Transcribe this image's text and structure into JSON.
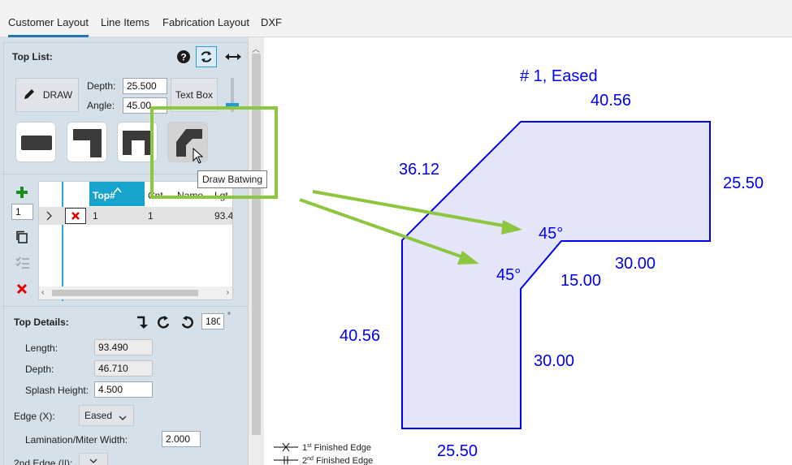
{
  "tabs": [
    {
      "label": "Customer Layout",
      "active": true
    },
    {
      "label": "Line Items",
      "active": false
    },
    {
      "label": "Fabrication Layout",
      "active": false
    },
    {
      "label": "DXF",
      "active": false
    }
  ],
  "top_list": {
    "title": "Top List:",
    "draw_label": "DRAW",
    "depth_label": "Depth:",
    "depth_value": "25.500",
    "angle_label": "Angle:",
    "angle_value": "45.00",
    "text_box_label": "Text Box",
    "tooltip": "Draw Batwing"
  },
  "grid": {
    "add_count": "1",
    "columns": [
      "Top#",
      "Cnt",
      "Name",
      "Lgt"
    ],
    "rows": [
      {
        "top": "1",
        "cnt": "1",
        "name": "",
        "lgt": "93.4"
      }
    ]
  },
  "top_details": {
    "title": "Top Details:",
    "rotate_value": "180",
    "degree_symbol": "°",
    "length_label": "Length:",
    "length_value": "93.490",
    "depth_label": "Depth:",
    "depth_value": "46.710",
    "splash_label": "Splash Height:",
    "splash_value": "4.500",
    "edge_label": "Edge (X):",
    "edge_value": "Eased",
    "lamination_label": "Lamination/Miter Width:",
    "lamination_value": "2.000",
    "edge2_label": "2nd Edge (||):"
  },
  "drawing": {
    "title": "# 1, Eased",
    "dims": {
      "top": "40.56",
      "right": "25.50",
      "diag_outer": "36.12",
      "angle_1": "45°",
      "angle_2": "45°",
      "inner_horizontal": "30.00",
      "inner_diag": "15.00",
      "left": "40.56",
      "inner_vertical": "30.00",
      "bottom": "25.50"
    },
    "legend": [
      {
        "label": "1",
        "sup": "st",
        "rest": " Finished Edge"
      },
      {
        "label": "2",
        "sup": "nd",
        "rest": " Finished Edge"
      }
    ],
    "colors": {
      "outline": "#0000ee",
      "fill": "#e6e6fa",
      "annotation": "#8dc63f"
    }
  }
}
